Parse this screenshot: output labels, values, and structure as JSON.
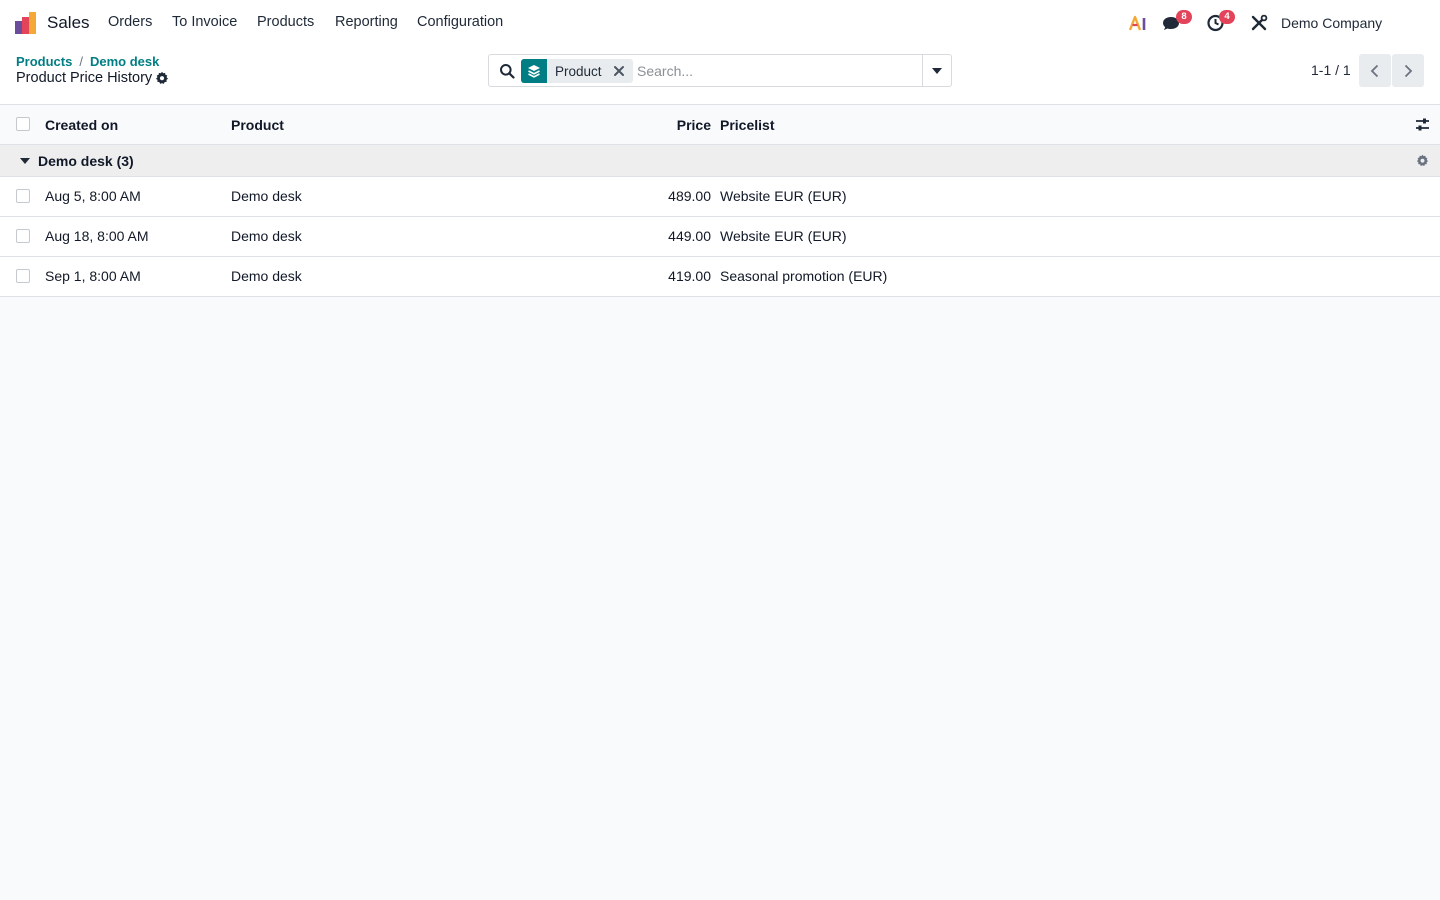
{
  "navbar": {
    "app_name": "Sales",
    "menu": [
      "Orders",
      "To Invoice",
      "Products",
      "Reporting",
      "Configuration"
    ],
    "messages_badge": "8",
    "activities_badge": "4",
    "company": "Demo Company"
  },
  "control_panel": {
    "breadcrumb": [
      "Products",
      "Demo desk"
    ],
    "breadcrumb_separator": "/",
    "title": "Product Price History",
    "search": {
      "facet_label": "Product",
      "placeholder": "Search..."
    },
    "pager": "1-1 / 1"
  },
  "list": {
    "columns": [
      "Created on",
      "Product",
      "Price",
      "Pricelist"
    ],
    "group": {
      "label": "Demo desk (3)"
    },
    "rows": [
      {
        "created_on": "Aug 5, 8:00 AM",
        "product": "Demo desk",
        "price": "489.00",
        "pricelist": "Website EUR (EUR)"
      },
      {
        "created_on": "Aug 18, 8:00 AM",
        "product": "Demo desk",
        "price": "449.00",
        "pricelist": "Website EUR (EUR)"
      },
      {
        "created_on": "Sep 1, 8:00 AM",
        "product": "Demo desk",
        "price": "419.00",
        "pricelist": "Seasonal promotion (EUR)"
      }
    ]
  },
  "colors": {
    "accent": "#017e84",
    "badge": "#e3445a",
    "background": "#f9fafb"
  },
  "icons": [
    "sales-app-logo",
    "ai-icon",
    "chat-icon",
    "activity-clock-icon",
    "tools-icon",
    "gear-icon",
    "search-icon",
    "layers-icon",
    "close-icon",
    "caret-down-icon",
    "chevron-left-icon",
    "chevron-right-icon",
    "optional-columns-icon"
  ]
}
